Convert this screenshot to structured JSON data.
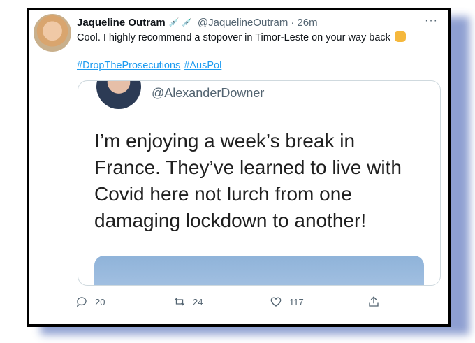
{
  "tweet": {
    "author_name": "Jaqueline Outram",
    "author_emoji": "💉 💉",
    "author_handle": "@JaquelineOutram",
    "separator": "·",
    "time": "26m",
    "text": "Cool. I highly recommend a stopover in Timor-Leste on your way back",
    "hashtags": [
      "#DropTheProsecutions",
      "#AusPol"
    ],
    "more_label": "···"
  },
  "quoted": {
    "handle": "@AlexanderDowner",
    "lines": [
      "I’m enjoying a week’s break in",
      "France. They’ve learned to live with",
      "Covid here not lurch from one",
      "damaging lockdown to another!"
    ]
  },
  "actions": {
    "reply_count": "20",
    "retweet_count": "24",
    "like_count": "117"
  },
  "icons": {
    "reply": "reply-icon",
    "retweet": "retweet-icon",
    "like": "heart-icon",
    "share": "share-icon",
    "more": "more-icon",
    "reaction": "thumbs-up-icon"
  },
  "colors": {
    "link": "#1d9bf0",
    "muted": "#536471",
    "border": "#cfd9de",
    "frame": "#000000",
    "shadow": "#7b8fc9"
  }
}
